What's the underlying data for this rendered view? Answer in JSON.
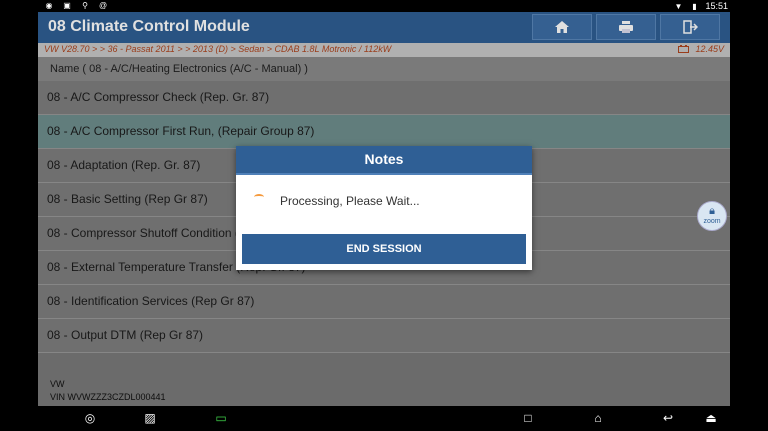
{
  "status_bar": {
    "time": "15:51",
    "left_icons": [
      "eye-icon",
      "image-icon",
      "usb-icon",
      "at-icon"
    ],
    "right_icons": [
      "wifi-icon",
      "battery-icon"
    ]
  },
  "header": {
    "title": "08 Climate Control Module",
    "buttons": [
      "home-icon",
      "print-icon",
      "exit-icon"
    ]
  },
  "breadcrumb": {
    "path": "VW V28.70 > > 36 - Passat 2011 > > 2013 (D) > Sedan > CDAB 1.8L Motronic / 112kW",
    "voltage": "12.45V"
  },
  "name_row": "Name ( 08 - A/C/Heating Electronics (A/C - Manual) )",
  "list": {
    "items": [
      "08 - A/C Compressor Check (Rep. Gr. 87)",
      "08 - A/C Compressor First Run, (Repair Group 87)",
      "08 - Adaptation (Rep. Gr. 87)",
      "08 - Basic Setting (Rep Gr 87)",
      "08 - Compressor Shutoff Condition (",
      "08 - External Temperature Transfer (Rep. Gr. 87)",
      "08 - Identification Services (Rep Gr 87)",
      "08 - Output DTM (Rep Gr 87)"
    ],
    "selected_index": 1
  },
  "footer": {
    "make": "VW",
    "vin": "VIN WVWZZZ3CZDL000441"
  },
  "dialog": {
    "title": "Notes",
    "message": "Processing, Please Wait...",
    "button": "END SESSION"
  },
  "zoom": {
    "label": "zoom"
  },
  "colors": {
    "header": "#2f5f95",
    "selected_row": "#6f8f8e",
    "breadcrumb_text": "#b0461f"
  },
  "nav_bar": [
    "browser-icon",
    "gallery-icon",
    "vci-icon",
    "recents-icon",
    "home-icon",
    "back-icon",
    "menu-icon"
  ]
}
